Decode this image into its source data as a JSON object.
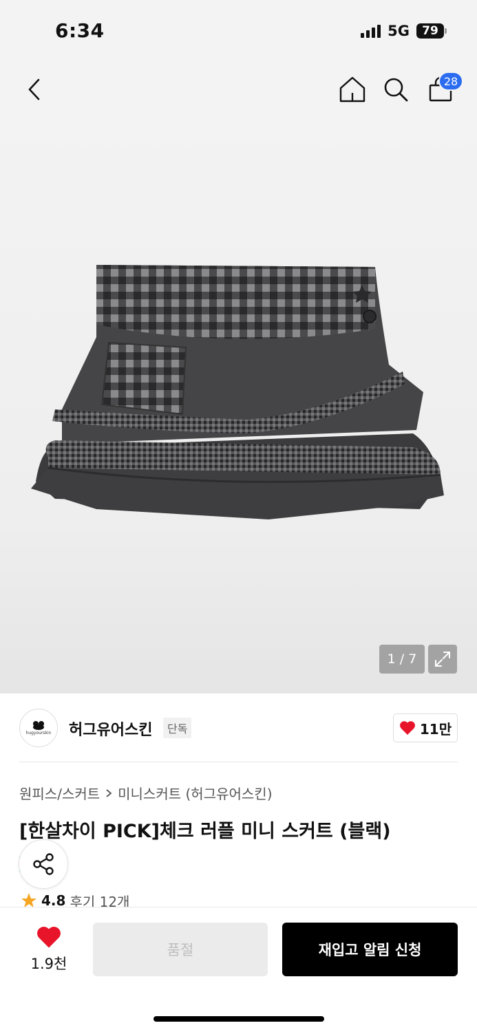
{
  "status": {
    "time": "6:34",
    "network": "5G",
    "battery": "79"
  },
  "nav": {
    "cart_badge": "28",
    "icons": [
      "back-icon",
      "home-icon",
      "search-icon",
      "cart-icon"
    ]
  },
  "gallery": {
    "counter": "1 / 7"
  },
  "brand": {
    "name": "허그유어스킨",
    "logo_text": "hugyourskin",
    "tag": "단독",
    "likes": "11만"
  },
  "product": {
    "breadcrumb": [
      "원피스/스커트",
      "미니스커트 (허그유어스킨)"
    ],
    "title": "[한살차이 PICK]체크 러플 미니 스커트 (블랙)",
    "rating": "4.8",
    "reviews": "후기 12개"
  },
  "bottom": {
    "wish_count": "1.9천",
    "soldout_label": "품절",
    "restock_label": "재입고 알림 신청"
  },
  "colors": {
    "accent": "#2b6cf0",
    "heart": "#e8142a",
    "star": "#f5a623"
  }
}
